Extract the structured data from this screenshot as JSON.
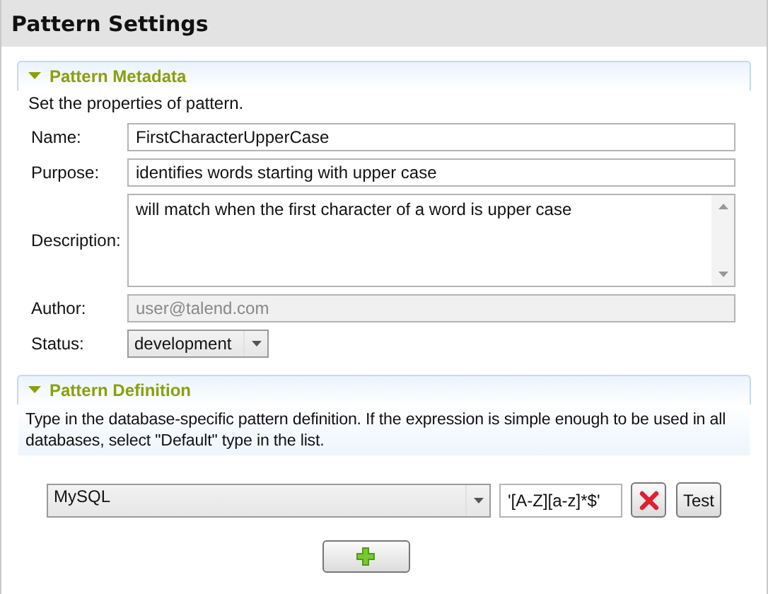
{
  "header": {
    "title": "Pattern Settings"
  },
  "metadata": {
    "title": "Pattern Metadata",
    "expanded": true,
    "intro": "Set the properties of pattern.",
    "fields": [
      {
        "kind": "text",
        "label": "Name:",
        "value": "FirstCharacterUpperCase",
        "disabled": false
      },
      {
        "kind": "text",
        "label": "Purpose:",
        "value": "identifies words starting with upper case",
        "disabled": false
      },
      {
        "kind": "textarea",
        "label": "Description:",
        "value": "will match when the first character of a word is upper case",
        "disabled": false
      },
      {
        "kind": "text",
        "label": "Author:",
        "value": "user@talend.com",
        "disabled": true
      },
      {
        "kind": "combo",
        "label": "Status:",
        "value": "development",
        "disabled": false
      }
    ]
  },
  "definition": {
    "title": "Pattern Definition",
    "expanded": true,
    "intro": "Type in the database-specific pattern definition. If the expression is simple enough to be used in all databases, select \"Default\" type in the list.",
    "expressions": [
      {
        "database": "MySQL",
        "expression": "'[A-Z][a-z]*$'",
        "test_label": "Test"
      }
    ]
  }
}
